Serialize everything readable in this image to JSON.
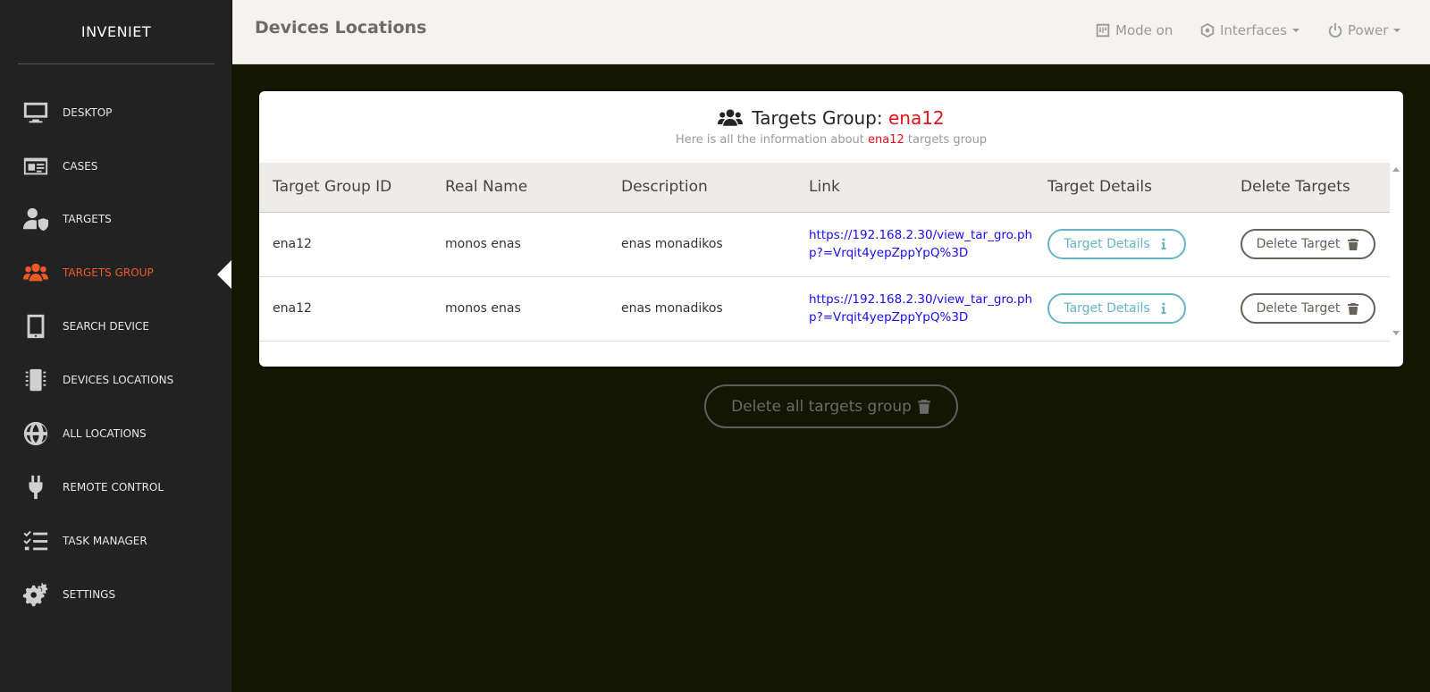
{
  "brand": "INVENIET",
  "sidebar": {
    "items": [
      {
        "label": "DESKTOP",
        "icon": "monitor-icon"
      },
      {
        "label": "CASES",
        "icon": "id-card-icon"
      },
      {
        "label": "TARGETS",
        "icon": "user-shield-icon"
      },
      {
        "label": "TARGETS GROUP",
        "icon": "users-icon",
        "active": true
      },
      {
        "label": "SEARCH DEVICE",
        "icon": "tablet-icon"
      },
      {
        "label": "DEVICES LOCATIONS",
        "icon": "chip-icon"
      },
      {
        "label": "ALL LOCATIONS",
        "icon": "globe-icon"
      },
      {
        "label": "REMOTE CONTROL",
        "icon": "plug-icon"
      },
      {
        "label": "TASK MANAGER",
        "icon": "tasks-icon"
      },
      {
        "label": "SETTINGS",
        "icon": "cogs-icon"
      }
    ]
  },
  "header": {
    "title": "Devices Locations",
    "mode": "Mode on",
    "interfaces": "Interfaces",
    "power": "Power"
  },
  "card": {
    "title_prefix": "Targets Group: ",
    "group_name": "ena12",
    "subtitle_pre": "Here is all the information about ",
    "subtitle_post": " targets group"
  },
  "table": {
    "columns": [
      "Target Group ID",
      "Real Name",
      "Description",
      "Link",
      "Target Details",
      "Delete Targets"
    ],
    "rows": [
      {
        "id": "ena12",
        "real_name": "monos enas",
        "description": "enas monadikos",
        "link": "https://192.168.2.30/view_tar_gro.php?=Vrqit4yepZppYpQ%3D",
        "details_label": "Target Details",
        "delete_label": "Delete Target"
      },
      {
        "id": "ena12",
        "real_name": "monos enas",
        "description": "enas monadikos",
        "link": "https://192.168.2.30/view_tar_gro.php?=Vrqit4yepZppYpQ%3D",
        "details_label": "Target Details",
        "delete_label": "Delete Target"
      }
    ]
  },
  "delete_all_label": "Delete all targets group",
  "colors": {
    "accent": "#f05a28",
    "highlight": "#e8101b",
    "link": "#1a0dff",
    "info": "#68b3c8"
  }
}
